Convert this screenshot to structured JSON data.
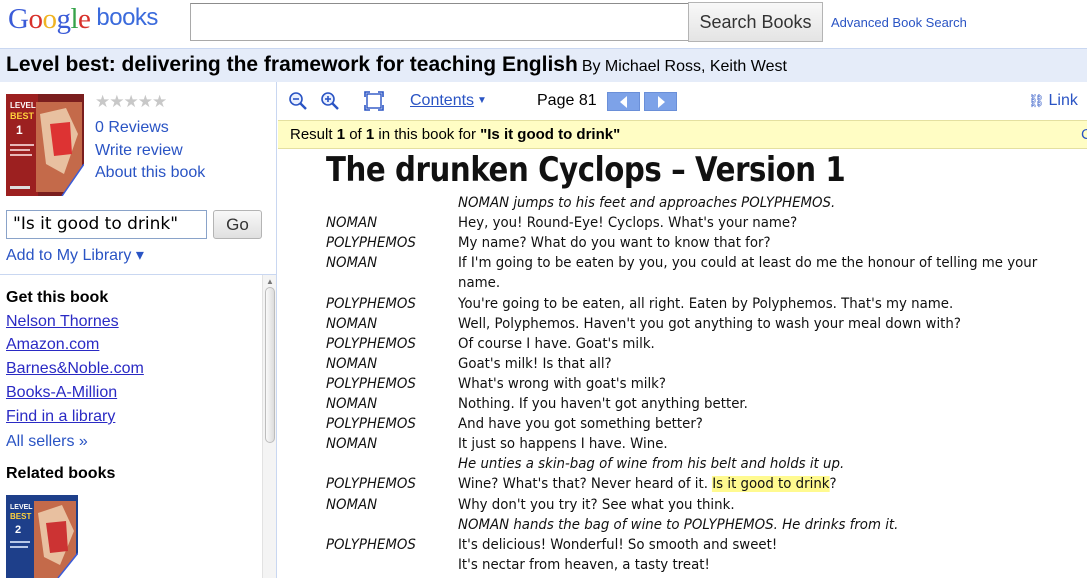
{
  "header": {
    "logo_google": [
      "G",
      "o",
      "o",
      "g",
      "l",
      "e"
    ],
    "logo_books": "books",
    "search_value": "",
    "search_button": "Search Books",
    "advanced_link": "Advanced Book Search"
  },
  "book": {
    "title": "Level best: delivering the framework for teaching English",
    "authors": "By Michael Ross, Keith West"
  },
  "sidebar": {
    "stars": "★★★★★",
    "rating_filled": 0,
    "reviews": "0 Reviews",
    "write_review": "Write review",
    "about": "About this book",
    "query": "\"Is it good to drink\"",
    "go": "Go",
    "add_library": "Add to My Library ▾",
    "get_book_heading": "Get this book",
    "sellers": [
      "Nelson Thornes",
      "Amazon.com",
      "Barnes&Noble.com",
      "Books-A-Million",
      "Find in a library"
    ],
    "all_sellers": "All sellers »",
    "related_heading": "Related books"
  },
  "toolbar": {
    "contents": "Contents",
    "page": "Page 81",
    "link": "Link"
  },
  "result": {
    "prefix": "Result",
    "index": "1",
    "of": "of",
    "total": "1",
    "middle": "in this book for",
    "query": "\"Is it good to drink\"",
    "edge": "C"
  },
  "page": {
    "title": "The drunken Cyclops – Version 1",
    "lines": [
      {
        "speaker": "",
        "text": "NOMAN jumps to his feet and approaches POLYPHEMOS.",
        "dir": true
      },
      {
        "speaker": "NOMAN",
        "text": "Hey, you! Round-Eye! Cyclops. What's your name?",
        "dir": false
      },
      {
        "speaker": "POLYPHEMOS",
        "text": "My name? What do you want to know that for?",
        "dir": false
      },
      {
        "speaker": "NOMAN",
        "text": "If I'm going to be eaten by you, you could at least do me the honour of telling me your",
        "dir": false
      },
      {
        "speaker": "",
        "text": "name.",
        "dir": false
      },
      {
        "speaker": "POLYPHEMOS",
        "text": "You're going to be eaten, all right. Eaten by Polyphemos. That's my name.",
        "dir": false
      },
      {
        "speaker": "NOMAN",
        "text": "Well, Polyphemos. Haven't you got anything to wash your meal down with?",
        "dir": false
      },
      {
        "speaker": "POLYPHEMOS",
        "text": "Of course I have. Goat's milk.",
        "dir": false
      },
      {
        "speaker": "NOMAN",
        "text": "Goat's milk! Is that all?",
        "dir": false
      },
      {
        "speaker": "POLYPHEMOS",
        "text": "What's wrong with goat's milk?",
        "dir": false
      },
      {
        "speaker": "NOMAN",
        "text": "Nothing. If you haven't got anything better.",
        "dir": false
      },
      {
        "speaker": "POLYPHEMOS",
        "text": "And have you got something better?",
        "dir": false
      },
      {
        "speaker": "NOMAN",
        "text": "It just so happens I have. Wine.",
        "dir": false
      },
      {
        "speaker": "",
        "text": "He unties a skin-bag of wine from his belt and holds it up.",
        "dir": true
      },
      {
        "speaker": "POLYPHEMOS",
        "text_before": "Wine? What's that? Never heard of it. ",
        "highlight": "Is it good to drink",
        "text_after": "?",
        "dir": false
      },
      {
        "speaker": "NOMAN",
        "text": "Why don't you try it? See what you think.",
        "dir": false
      },
      {
        "speaker": "",
        "text": "NOMAN hands the bag of wine to POLYPHEMOS. He drinks from it.",
        "dir": true
      },
      {
        "speaker": "POLYPHEMOS",
        "text": "It's delicious! Wonderful! So smooth and sweet!",
        "dir": false
      },
      {
        "speaker": "",
        "text": "It's nectar from heaven, a tasty treat!",
        "dir": false
      }
    ]
  },
  "colors": {
    "link": "#2a54c4",
    "titlebar_bg": "#e5ecf9",
    "result_bg": "#fffdc4",
    "highlight": "#fffa90"
  }
}
